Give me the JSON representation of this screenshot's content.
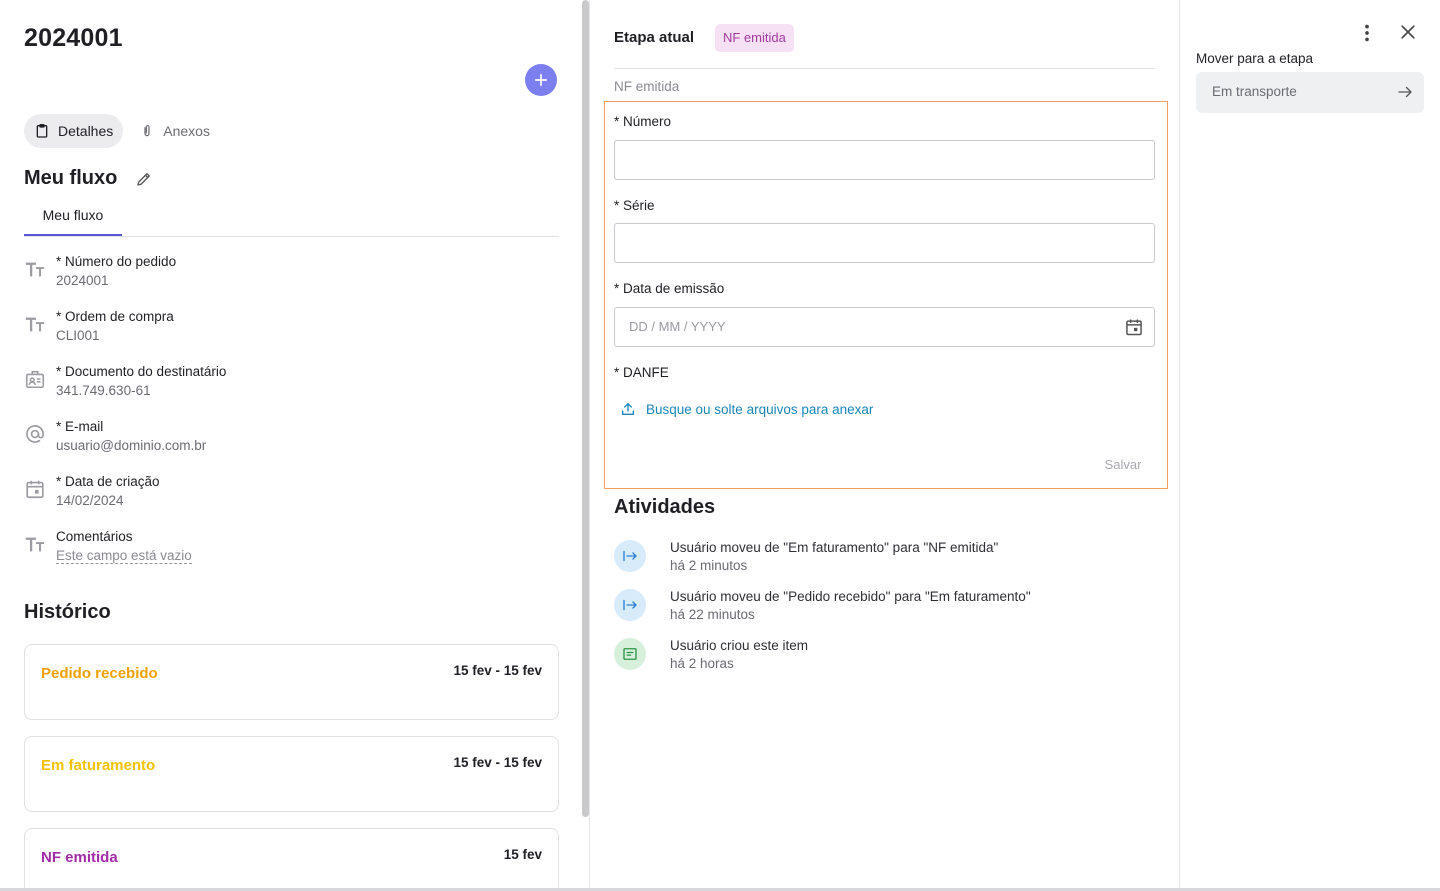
{
  "item": {
    "id": "2024001"
  },
  "tabs": [
    {
      "label": "Detalhes",
      "icon": "clipboard-icon"
    },
    {
      "label": "Anexos",
      "icon": "paperclip-icon"
    }
  ],
  "flow": {
    "title": "Meu fluxo",
    "tab_label": "Meu fluxo",
    "fields": [
      {
        "label": "* Número do pedido",
        "value": "2024001",
        "icon": "text-type-icon"
      },
      {
        "label": "* Ordem de compra",
        "value": "CLI001",
        "icon": "text-type-icon"
      },
      {
        "label": "* Documento do destinatário",
        "value": "341.749.630-61",
        "icon": "id-card-icon"
      },
      {
        "label": "* E-mail",
        "value": "usuario@dominio.com.br",
        "icon": "at-sign-icon"
      },
      {
        "label": "* Data de criação",
        "value": "14/02/2024",
        "icon": "calendar-icon"
      },
      {
        "label": "Comentários",
        "value": "Este campo está vazio",
        "icon": "text-type-icon"
      }
    ]
  },
  "history": {
    "title": "Histórico",
    "items": [
      {
        "name": "Pedido recebido",
        "dates": "15 fev - 15 fev",
        "color": "#f0a000"
      },
      {
        "name": "Em faturamento",
        "dates": "15 fev - 15 fev",
        "color": "#f2c200"
      },
      {
        "name": "NF emitida",
        "dates": "15 fev",
        "color": "#a32ba8"
      }
    ]
  },
  "stage": {
    "label": "Etapa atual",
    "badge": "NF emitida",
    "form_caption": "NF emitida",
    "form": {
      "numero_label": "* Número",
      "serie_label": "* Série",
      "data_label": "* Data de emissão",
      "data_placeholder": "DD / MM / YYYY",
      "danfe_label": "* DANFE",
      "upload_text": "Busque ou solte arquivos para anexar",
      "save_label": "Salvar"
    }
  },
  "activities": {
    "title": "Atividades",
    "items": [
      {
        "text": "Usuário moveu de \"Em faturamento\" para \"NF emitida\"",
        "time": "há 2 minutos",
        "icon": "move-arrow-icon"
      },
      {
        "text": "Usuário moveu de \"Pedido recebido\" para \"Em faturamento\"",
        "time": "há 22 minutos",
        "icon": "move-arrow-icon"
      },
      {
        "text": "Usuário criou este item",
        "time": "há 2 horas",
        "icon": "card-created-icon"
      }
    ]
  },
  "move": {
    "label": "Mover para a etapa",
    "target": "Em transporte"
  }
}
